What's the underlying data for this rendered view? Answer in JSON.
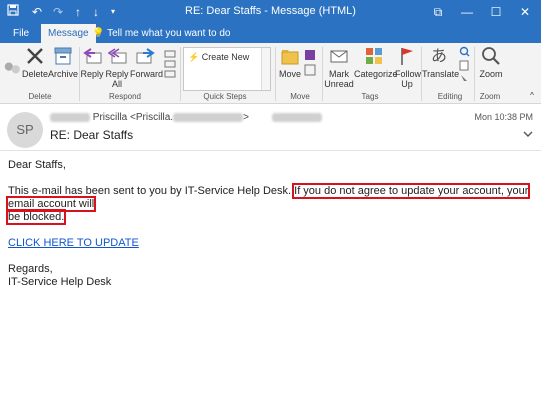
{
  "titlebar": {
    "title": "RE: Dear Staffs  -  Message (HTML)",
    "save_icon": "save-icon",
    "undo_icon": "undo-icon",
    "redo_icon": "redo-icon",
    "up_icon": "up-arrow-icon",
    "down_icon": "down-arrow-icon",
    "customize_icon": "customize-icon",
    "ribbon_display": "⧉",
    "minimize": "—",
    "maximize": "☐",
    "close": "✕"
  },
  "tabs": {
    "file": "File",
    "message": "Message",
    "tell_me": "Tell me what you want to do"
  },
  "ribbon": {
    "delete": {
      "ignore_icon": "ignore-icon",
      "delete": "Delete",
      "archive": "Archive",
      "group": "Delete"
    },
    "respond": {
      "reply": "Reply",
      "reply_all_1": "Reply",
      "reply_all_2": "All",
      "forward": "Forward",
      "group": "Respond"
    },
    "quick_steps": {
      "create_new": "Create New",
      "group": "Quick Steps"
    },
    "move": {
      "move": "Move",
      "group": "Move"
    },
    "tags": {
      "mark_unread_1": "Mark",
      "mark_unread_2": "Unread",
      "categorize": "Categorize",
      "follow_up_1": "Follow",
      "follow_up_2": "Up",
      "group": "Tags"
    },
    "editing": {
      "translate": "Translate",
      "group": "Editing"
    },
    "zoom": {
      "zoom": "Zoom",
      "group": "Zoom"
    }
  },
  "header": {
    "avatar_initials": "SP",
    "sender_name": "Priscilla",
    "sender_email_prefix": "<Priscilla.",
    "subject": "RE: Dear Staffs",
    "timestamp": "Mon 10:38 PM",
    "expand_icon": "chevron-down-icon"
  },
  "body": {
    "greeting": "Dear Staffs,",
    "line1_pre": "This e-mail has been sent to you by IT-Service Help Desk.",
    "line1_highlight": "If you do not agree to update your account, your email account will",
    "line2_highlight": "be blocked.",
    "link": "CLICK HERE TO UPDATE",
    "regards": "Regards,",
    "signature": "IT-Service Help Desk"
  },
  "colors": {
    "titlebar_bg": "#2b72c2",
    "ribbon_bg": "#f3f3f3",
    "highlight_border": "#d9111d",
    "link": "#1155cc"
  }
}
